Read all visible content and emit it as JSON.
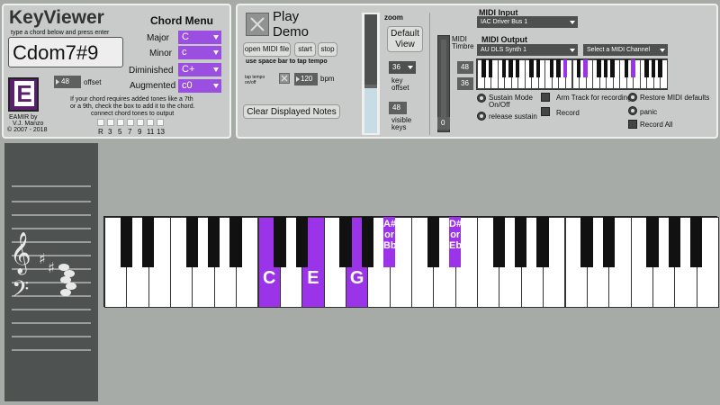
{
  "app": {
    "title": "KeyViewer",
    "subtitle": "type a chord below and press enter",
    "chord_input": "Cdom7#9",
    "offset_value": "48",
    "offset_label": "offset",
    "logo_letter": "E",
    "credit_lines": [
      "EAMIR by",
      "V.J. Manzo",
      "© 2007 - 2018"
    ],
    "added_tones_text": [
      "If your chord requires added tones like a 7th",
      "or a 9th, check the box to add it to the chord.",
      "connect chord tones to output"
    ],
    "tone_labels": [
      "R",
      "3",
      "5",
      "7",
      "9",
      "11",
      "13"
    ]
  },
  "chord_menu": {
    "title": "Chord Menu",
    "rows": [
      {
        "label": "Major",
        "value": "C"
      },
      {
        "label": "Minor",
        "value": "c"
      },
      {
        "label": "Diminished",
        "value": "C+"
      },
      {
        "label": "Augmented",
        "value": "c0"
      }
    ]
  },
  "demo": {
    "play_label_1": "Play",
    "play_label_2": "Demo",
    "open_midi": "open MIDI file",
    "start": "start",
    "stop": "stop",
    "tap_hint": "use space bar to tap tempo",
    "tap_label_1": "tap tempo",
    "tap_label_2": "on/off",
    "bpm_value": "120",
    "bpm_label": "bpm",
    "clear": "Clear Displayed Notes"
  },
  "zoom": {
    "label": "zoom",
    "default_1": "Default",
    "default_2": "View",
    "key_offset_value": "36",
    "key_offset_1": "key",
    "key_offset_2": "offset",
    "visible_keys_value": "48",
    "visible_keys_1": "visible",
    "visible_keys_2": "keys"
  },
  "midi": {
    "input_title": "MIDI Input",
    "input_value": "IAC Driver Bus 1",
    "output_title": "MIDI Output",
    "output_value": "AU DLS Synth 1",
    "channel_value": "Select a MIDI Channel",
    "timbre_1": "MIDI",
    "timbre_2": "Timbre",
    "timbre_value": "0",
    "low_value": "48",
    "high_value": "36",
    "sustain_1": "Sustain Mode",
    "sustain_2": "On/Off",
    "release": "release sustain",
    "arm": "Arm Track for recording",
    "record": "Record",
    "restore": "Restore MIDI defaults",
    "panic": "panic",
    "record_all": "Record All"
  },
  "keyboard": {
    "highlight_color": "#9b33e8",
    "labels": [
      {
        "key": "C",
        "lines": [
          "C"
        ]
      },
      {
        "key": "E",
        "lines": [
          "E"
        ]
      },
      {
        "key": "G",
        "lines": [
          "G"
        ]
      },
      {
        "key": "A#",
        "lines": [
          "A#",
          "or",
          "Bb"
        ]
      },
      {
        "key": "D#",
        "lines": [
          "D#",
          "or",
          "Eb"
        ]
      }
    ]
  }
}
